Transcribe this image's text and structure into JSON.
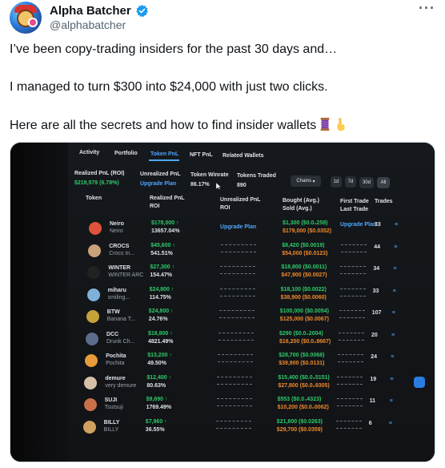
{
  "author": {
    "name": "Alpha Batcher",
    "handle": "@alphabatcher"
  },
  "more_glyph": "···",
  "tweet": {
    "line1": "I’ve been copy-trading insiders for the past 30 days and…",
    "line2": "I managed to turn $300 into $24,000 with just two clicks.",
    "line3": "Here are all the secrets and how to find insider wallets",
    "emojis": [
      "thread-spool-icon",
      "pointing-down-icon"
    ]
  },
  "media": {
    "tabs": [
      "Activity",
      "Portfolio",
      "Token PnL",
      "NFT PnL",
      "Related Wallets"
    ],
    "active_tab": "Token PnL",
    "summary": {
      "realized_label": "Realized PnL (ROI)",
      "realized_value": "$219,579 (6.78%)",
      "unrealized_label": "Unrealized PnL",
      "unrealized_value": "Upgrade Plan",
      "winrate_label": "Token Winrate",
      "winrate_value": "86.17%",
      "traded_label": "Tokens Traded",
      "traded_value": "890"
    },
    "filters": {
      "chains": "Chains",
      "periods": [
        "1d",
        "7d",
        "30d",
        "All"
      ]
    },
    "columns": {
      "token": "Token",
      "realized_1": "Realized PnL",
      "realized_2": "ROI",
      "unrealized_1": "Unrealized PnL",
      "unrealized_2": "ROI",
      "bought_1": "Bought (Avg.)",
      "bought_2": "Sold (Avg.)",
      "first_1": "First Trade",
      "first_2": "Last Trade",
      "trades": "Trades"
    },
    "upgrade_plan": "Upgrade Plan",
    "rows": [
      {
        "sym": "Neiro",
        "name": "Neiro",
        "pnl": "$178,000 ↑",
        "roi": "13657.04%",
        "bought": "$1,300 ($0.0₂258)",
        "sold": "$179,000 ($0.0352)",
        "trades": "33",
        "color": "#e0533a"
      },
      {
        "sym": "CROCS",
        "name": "Crocs In...",
        "pnl": "$45,600 ↑",
        "roi": "541.51%",
        "bought": "$8,420 ($0.0019)",
        "sold": "$54,000 ($0.0123)",
        "trades": "44",
        "color": "#c9a27a"
      },
      {
        "sym": "WINTER",
        "name": "WINTER ARC",
        "pnl": "$27,300 ↑",
        "roi": "154.47%",
        "bought": "$18,800 ($0.0011)",
        "sold": "$47,900 ($0.0027)",
        "trades": "34",
        "color": "#222222"
      },
      {
        "sym": "miharu",
        "name": "smiling...",
        "pnl": "$24,800 ↑",
        "roi": "114.75%",
        "bought": "$18,100 ($0.0022)",
        "sold": "$38,900 ($0.0060)",
        "trades": "33",
        "color": "#7fb0d8"
      },
      {
        "sym": "BTW",
        "name": "Banana T...",
        "pnl": "$24,800 ↑",
        "roi": "24.76%",
        "bought": "$100,000 ($0.0054)",
        "sold": "$125,000 ($0.0067)",
        "trades": "107",
        "color": "#c6a13a"
      },
      {
        "sym": "DCC",
        "name": "Drunk Ch...",
        "pnl": "$18,800 ↑",
        "roi": "4821.49%",
        "bought": "$290 ($0.0₄2004)",
        "sold": "$16,200 ($0.0₂8667)",
        "trades": "20",
        "color": "#5b6d8a"
      },
      {
        "sym": "Pochita",
        "name": "Pochita",
        "pnl": "$13,200 ↑",
        "roi": "49.50%",
        "bought": "$28,700 ($0.0068)",
        "sold": "$39,900 ($0.0131)",
        "trades": "24",
        "color": "#e79a3a"
      },
      {
        "sym": "demure",
        "name": "very demure",
        "pnl": "$12,400 ↑",
        "roi": "80.63%",
        "bought": "$15,400 ($0.0₃5151)",
        "sold": "$27,800 ($0.0₃9305)",
        "trades": "19",
        "color": "#d8c0a8"
      },
      {
        "sym": "SUJI",
        "name": "Tsutsuji",
        "pnl": "$9,690 ↑",
        "roi": "1769.49%",
        "bought": "$553 ($0.0₄4323)",
        "sold": "$10,200 ($0.0₂0062)",
        "trades": "11",
        "color": "#c96f4a"
      },
      {
        "sym": "BILLY",
        "name": "BILLY",
        "pnl": "$7,960 ↑",
        "roi": "36.55%",
        "bought": "$21,800 ($0.0263)",
        "sold": "$29,700 ($0.0359)",
        "trades": "6",
        "color": "#d0a060"
      }
    ]
  }
}
